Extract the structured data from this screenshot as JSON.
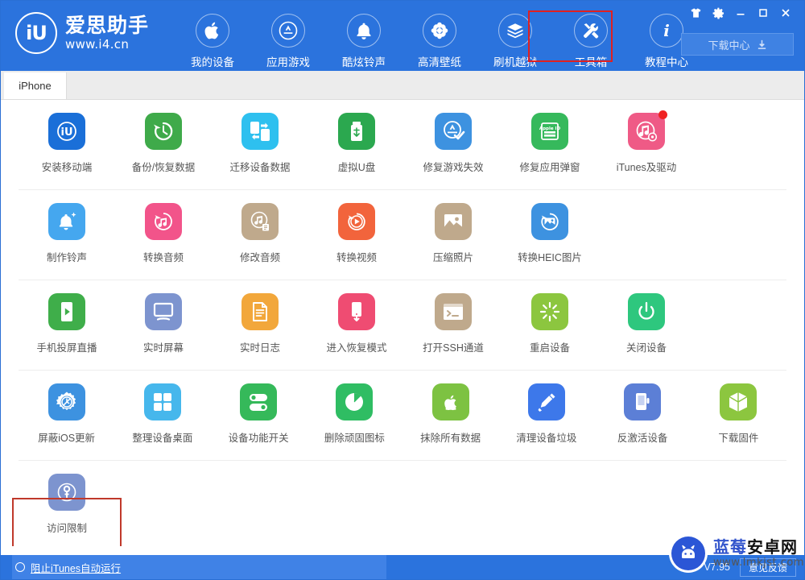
{
  "app": {
    "brand_name": "爱思助手",
    "brand_url": "www.i4.cn",
    "logo_text": "iU",
    "version": "V7.95"
  },
  "header": {
    "nav_items": [
      {
        "label": "我的设备",
        "icon": "apple-icon",
        "active": false
      },
      {
        "label": "应用游戏",
        "icon": "appstore-icon",
        "active": false
      },
      {
        "label": "酷炫铃声",
        "icon": "bell-icon",
        "active": false
      },
      {
        "label": "高清壁纸",
        "icon": "flower-icon",
        "active": false
      },
      {
        "label": "刷机越狱",
        "icon": "box-icon",
        "active": false
      },
      {
        "label": "工具箱",
        "icon": "tools-icon",
        "active": true
      },
      {
        "label": "教程中心",
        "icon": "info-icon",
        "active": false
      }
    ],
    "window_controls": [
      {
        "name": "skin-icon",
        "glyph": "👕"
      },
      {
        "name": "settings-gear-icon",
        "glyph": "⚙"
      },
      {
        "name": "minimize-icon",
        "glyph": "—"
      },
      {
        "name": "maximize-icon",
        "glyph": "□"
      },
      {
        "name": "close-icon",
        "glyph": "✕"
      }
    ],
    "download_center_label": "下载中心",
    "highlight_color": "#e02020"
  },
  "tabs": [
    {
      "label": "iPhone",
      "active": true
    }
  ],
  "toolbox": {
    "highlight_color": "#c0392b",
    "rows": [
      [
        {
          "label": "安装移动端",
          "icon": "i4-app-icon",
          "color": "#1a6fd8",
          "badge": false
        },
        {
          "label": "备份/恢复数据",
          "icon": "backup-restore-icon",
          "color": "#3faa4a",
          "badge": false
        },
        {
          "label": "迁移设备数据",
          "icon": "migrate-data-icon",
          "color": "#2ec0ef",
          "badge": false
        },
        {
          "label": "虚拟U盘",
          "icon": "usb-drive-icon",
          "color": "#2ba84f",
          "badge": false
        },
        {
          "label": "修复游戏失效",
          "icon": "fix-game-icon",
          "color": "#3d92e0",
          "badge": false
        },
        {
          "label": "修复应用弹窗",
          "icon": "appleid-popup-icon",
          "color": "#36b95c",
          "badge": false
        },
        {
          "label": "iTunes及驱动",
          "icon": "itunes-driver-icon",
          "color": "#ef5a86",
          "badge": true
        }
      ],
      [
        {
          "label": "制作铃声",
          "icon": "make-ringtone-icon",
          "color": "#45a7ef",
          "badge": false
        },
        {
          "label": "转换音频",
          "icon": "convert-audio-icon",
          "color": "#f2548a",
          "badge": false
        },
        {
          "label": "修改音频",
          "icon": "edit-audio-icon",
          "color": "#bfa98c",
          "badge": false
        },
        {
          "label": "转换视频",
          "icon": "convert-video-icon",
          "color": "#f2643c",
          "badge": false
        },
        {
          "label": "压缩照片",
          "icon": "compress-photo-icon",
          "color": "#bfa98c",
          "badge": false
        },
        {
          "label": "转换HEIC图片",
          "icon": "heic-convert-icon",
          "color": "#3d92e0",
          "badge": false
        }
      ],
      [
        {
          "label": "手机投屏直播",
          "icon": "screen-cast-icon",
          "color": "#3fae4a",
          "badge": false
        },
        {
          "label": "实时屏幕",
          "icon": "live-screen-icon",
          "color": "#7d94cf",
          "badge": false
        },
        {
          "label": "实时日志",
          "icon": "live-log-icon",
          "color": "#f2a73b",
          "badge": false
        },
        {
          "label": "进入恢复模式",
          "icon": "recovery-mode-icon",
          "color": "#ef4c72",
          "badge": false
        },
        {
          "label": "打开SSH通道",
          "icon": "ssh-tunnel-icon",
          "color": "#bfa98c",
          "badge": false
        },
        {
          "label": "重启设备",
          "icon": "reboot-device-icon",
          "color": "#8cc63f",
          "badge": false
        },
        {
          "label": "关闭设备",
          "icon": "shutdown-device-icon",
          "color": "#2ec77e",
          "badge": false
        }
      ],
      [
        {
          "label": "屏蔽iOS更新",
          "icon": "block-ios-update-icon",
          "color": "#3d92e0",
          "badge": false,
          "highlighted": true
        },
        {
          "label": "整理设备桌面",
          "icon": "arrange-desktop-icon",
          "color": "#46b7ec",
          "badge": false
        },
        {
          "label": "设备功能开关",
          "icon": "feature-toggle-icon",
          "color": "#35b95a",
          "badge": false
        },
        {
          "label": "删除顽固图标",
          "icon": "delete-icon-icon",
          "color": "#2fbd63",
          "badge": false
        },
        {
          "label": "抹除所有数据",
          "icon": "erase-data-icon",
          "color": "#7dc242",
          "badge": false
        },
        {
          "label": "清理设备垃圾",
          "icon": "clean-junk-icon",
          "color": "#3d78ea",
          "badge": false
        },
        {
          "label": "反激活设备",
          "icon": "deactivate-icon",
          "color": "#5c7fd6",
          "badge": false
        },
        {
          "label": "下载固件",
          "icon": "download-firmware-icon",
          "color": "#8cc63f",
          "badge": false
        }
      ],
      [
        {
          "label": "访问限制",
          "icon": "access-restriction-icon",
          "color": "#7d94cf",
          "badge": false
        }
      ]
    ]
  },
  "statusbar": {
    "block_itunes_label": "阻止iTunes自动运行",
    "version": "V7.95",
    "feedback_label": "意见反馈"
  },
  "watermark": {
    "title_part1": "蓝莓",
    "title_part2": "安卓网",
    "url": "www.lmkjst.com"
  }
}
